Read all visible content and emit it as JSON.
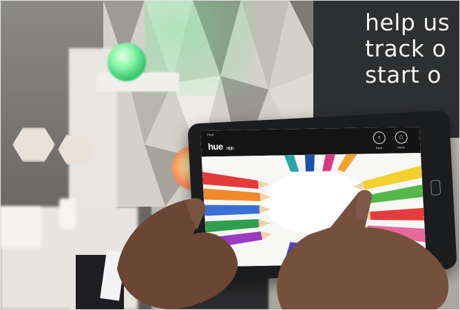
{
  "poster": {
    "lines": [
      "help us",
      "track o",
      "start o"
    ],
    "background": "#2e2f31",
    "text_color": "#f4f4f2"
  },
  "app": {
    "tiny_title": "Hue",
    "logo": "hue",
    "logo_suffix": "app",
    "back_label": "Back",
    "home_label": "Home",
    "back_icon": "back-arrow-icon",
    "home_icon": "home-icon",
    "screen_content": "colored pencils arranged in a circle"
  },
  "colors": {
    "lamp_green": "#33c56b",
    "lamp_orange": "#ff8a5a",
    "tablet": "#1b1c1e"
  }
}
